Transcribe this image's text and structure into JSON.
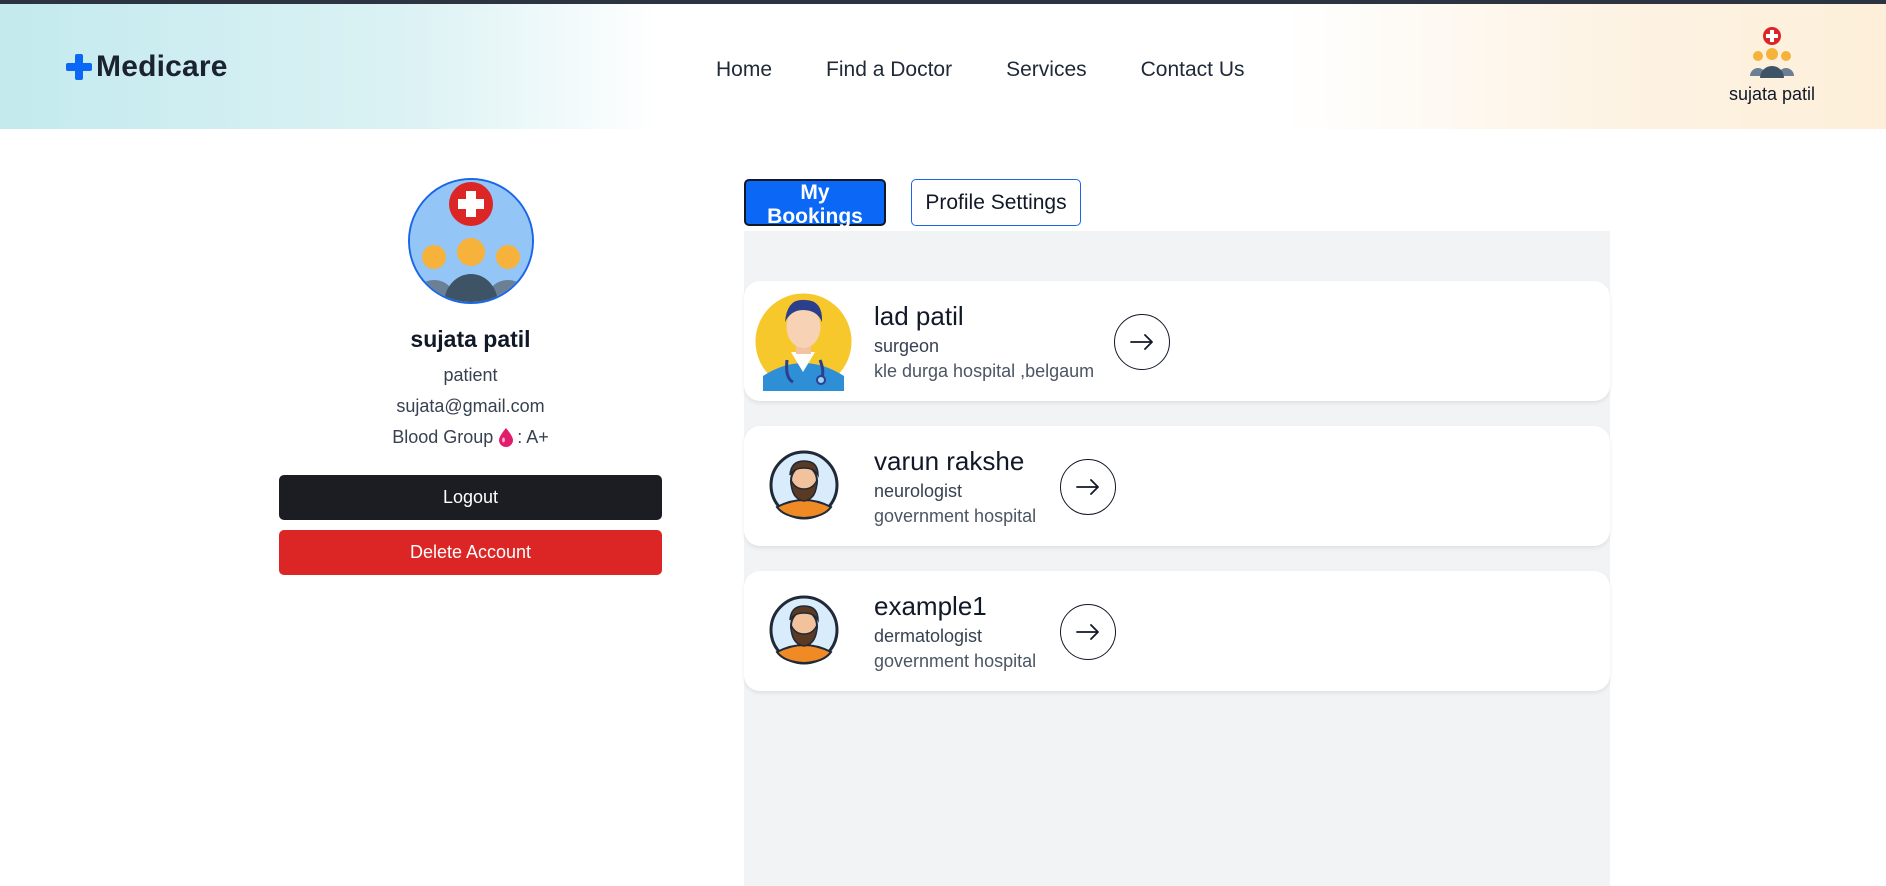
{
  "header": {
    "logo_text": "Medicare",
    "nav": [
      "Home",
      "Find a Doctor",
      "Services",
      "Contact Us"
    ],
    "user_name": "sujata patil"
  },
  "profile": {
    "name": "sujata patil",
    "role": "patient",
    "email": "sujata@gmail.com",
    "blood_label": "Blood Group",
    "blood_value": ": A+",
    "logout_label": "Logout",
    "delete_label": "Delete Account"
  },
  "tabs": {
    "active": "My Bookings",
    "inactive": "Profile Settings"
  },
  "bookings": [
    {
      "name": "lad patil",
      "specialization": "surgeon",
      "hospital": "kle durga hospital ,belgaum",
      "avatar": "doctor-avatar"
    },
    {
      "name": "varun rakshe",
      "specialization": "neurologist",
      "hospital": "government hospital",
      "avatar": "bearded-man-avatar"
    },
    {
      "name": "example1",
      "specialization": "dermatologist",
      "hospital": "government hospital",
      "avatar": "bearded-man-avatar"
    }
  ],
  "colors": {
    "brand": "#0b67f5",
    "danger": "#dc2626",
    "dark": "#1c1d22"
  }
}
